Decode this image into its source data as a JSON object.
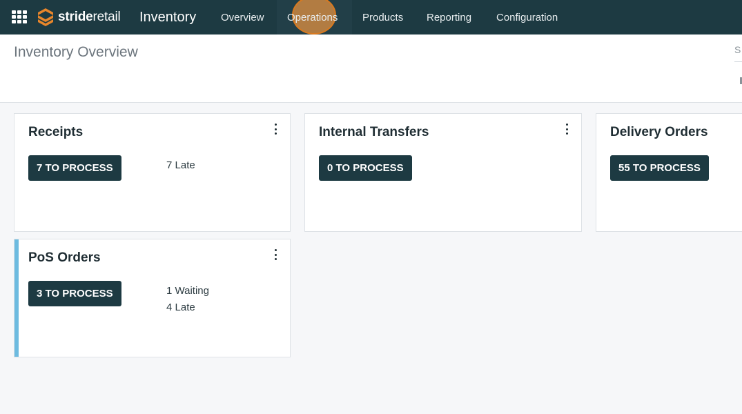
{
  "topbar": {
    "brand": {
      "part1": "stride",
      "part2": "retail"
    },
    "app_title": "Inventory",
    "menu": [
      {
        "label": "Overview"
      },
      {
        "label": "Operations"
      },
      {
        "label": "Products"
      },
      {
        "label": "Reporting"
      },
      {
        "label": "Configuration"
      }
    ],
    "colors": {
      "bar": "#1d3a42",
      "logo_accent": "#e8862b"
    }
  },
  "control_panel": {
    "breadcrumb": "Inventory Overview",
    "search_partial": "S"
  },
  "cards": [
    {
      "title": "Receipts",
      "button": "7 TO PROCESS",
      "stats": [
        "7 Late"
      ]
    },
    {
      "title": "Internal Transfers",
      "button": "0 TO PROCESS",
      "stats": []
    },
    {
      "title": "Delivery Orders",
      "button": "55 TO PROCESS",
      "stats": []
    },
    {
      "title": "PoS Orders",
      "button": "3 TO PROCESS",
      "stats": [
        "1 Waiting",
        "4 Late"
      ],
      "accent": "#6dbbe0"
    }
  ]
}
